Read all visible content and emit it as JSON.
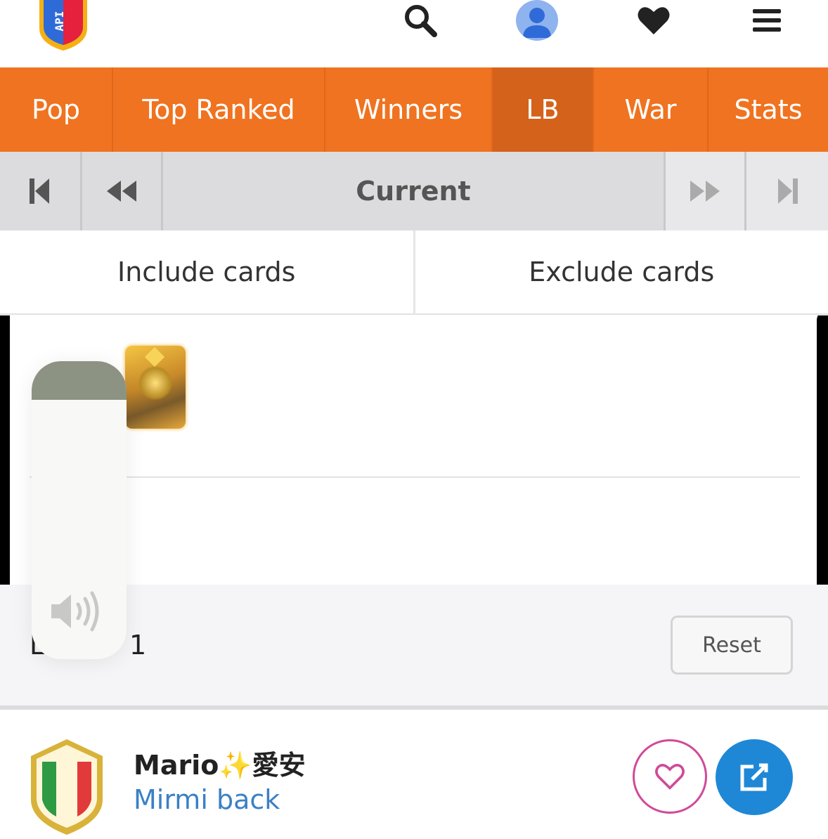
{
  "header": {
    "logo_text": "API",
    "icons": [
      "search-icon",
      "user-avatar-icon",
      "heart-icon",
      "menu-icon"
    ]
  },
  "tabs": [
    {
      "label": "Pop",
      "active": false
    },
    {
      "label": "Top Ranked",
      "active": false
    },
    {
      "label": "Winners",
      "active": false
    },
    {
      "label": "LB",
      "active": true
    },
    {
      "label": "War",
      "active": false
    },
    {
      "label": "Stats",
      "active": false
    }
  ],
  "pager": {
    "current_label": "Current"
  },
  "filters": {
    "include_label": "Include cards",
    "exclude_label": "Exclude cards",
    "selected_text": "L          1",
    "reset_label": "Reset"
  },
  "volume": {
    "level": 0.13
  },
  "player": {
    "name": "Mario✨愛安",
    "clan": "Mirmi back"
  },
  "colors": {
    "accent": "#ef7320",
    "active_tab": "#d5621a",
    "link": "#3b80c6",
    "fav": "#d04a98",
    "open": "#1f88d6"
  }
}
